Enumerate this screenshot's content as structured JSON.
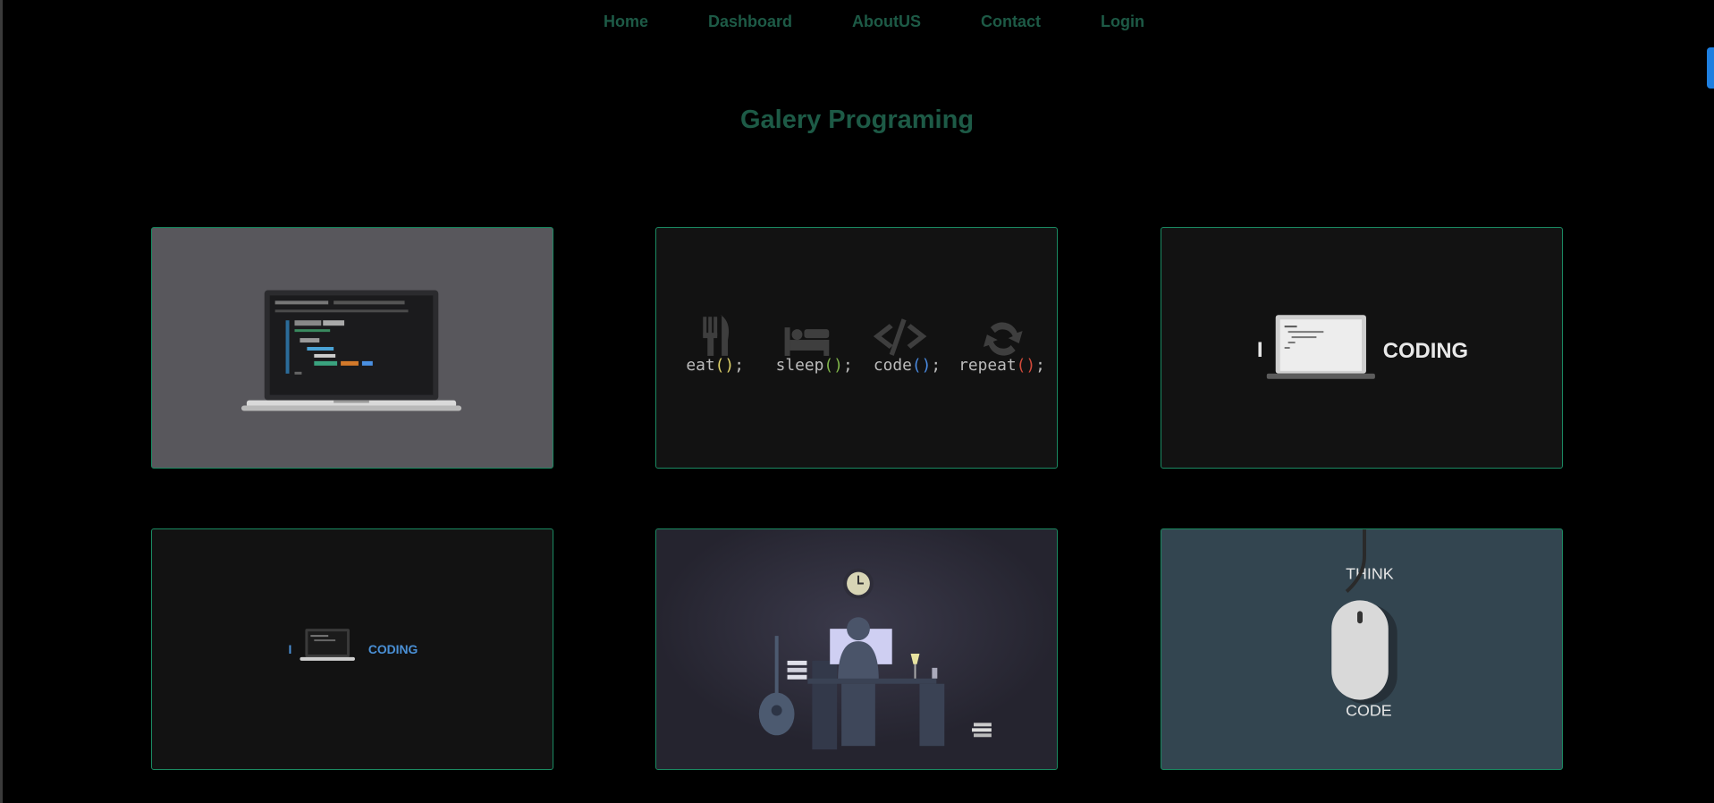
{
  "nav": {
    "home": "Home",
    "dashboard": "Dashboard",
    "about": "AboutUS",
    "contact": "Contact",
    "login": "Login"
  },
  "page": {
    "title": "Galery Programing"
  },
  "gallery": {
    "card2": {
      "eat": "eat",
      "sleep": "sleep",
      "code": "code",
      "repeat": "repeat",
      "parens": "()",
      "semi": ";"
    },
    "card3": {
      "i": "I",
      "word": "CODING"
    },
    "card4": {
      "i": "I",
      "word": "CODING"
    },
    "card6": {
      "top": "THINK",
      "bottom": "CODE"
    }
  },
  "colors": {
    "accent": "#1d5a46",
    "border": "#1b8a62",
    "background": "#000000"
  }
}
